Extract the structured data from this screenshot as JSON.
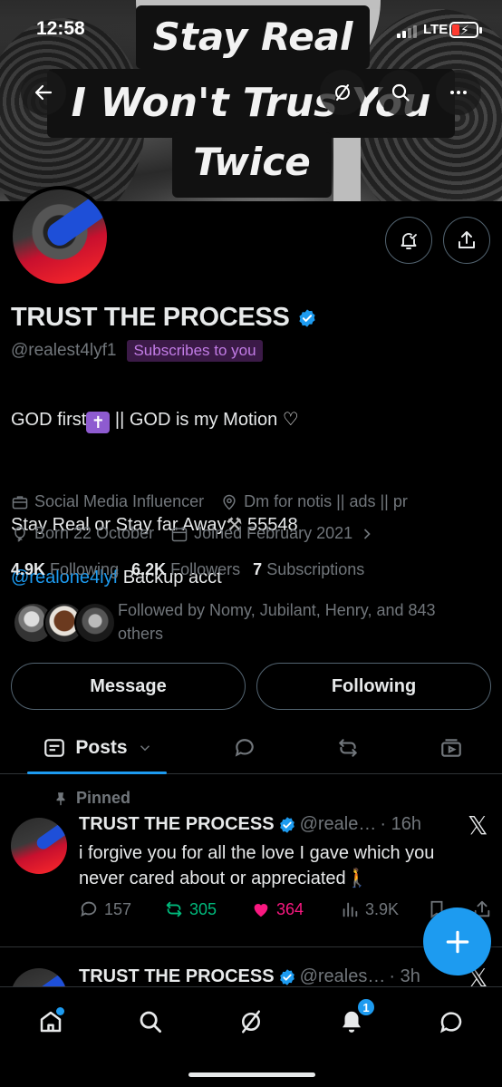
{
  "status_bar": {
    "time": "12:58",
    "network": "LTE"
  },
  "banner": {
    "captions": [
      "Stay Real",
      "I Won't Trus  You",
      "Twice"
    ]
  },
  "header_buttons": {
    "back": "back-arrow-icon",
    "grok": "grok-icon",
    "search": "search-icon",
    "more": "more-icon"
  },
  "profile": {
    "display_name": "TRUST THE PROCESS",
    "handle": "@realest4lyf1",
    "subscribes_badge": "Subscribes to you",
    "bio_line1_a": "GOD first",
    "bio_line1_b": " || GOD is my Motion",
    "bio_line2": "Stay Real or Stay far Away",
    "bio_line2_num": " 55548",
    "bio_link": "@realone4lyf",
    "bio_link_suffix": " Backup acct",
    "category": "Social Media Influencer",
    "location": "Dm for notis || ads || pr",
    "born": "Born 22 October",
    "joined": "Joined February 2021",
    "following_count": "4.9K",
    "following_label": "Following",
    "followers_count": "6.2K",
    "followers_label": "Followers",
    "subscriptions_count": "7",
    "subscriptions_label": "Subscriptions",
    "followed_by": "Followed by Nomy, Jubilant, Henry, and 843 others"
  },
  "buttons": {
    "message": "Message",
    "following": "Following"
  },
  "tabs": {
    "posts": "Posts"
  },
  "posts": [
    {
      "pinned_label": "Pinned",
      "name": "TRUST THE PROCESS",
      "handle": "@reale…",
      "time": "· 16h",
      "text": "i forgive you for all the love I gave which you never cared about or appreciated",
      "replies": "157",
      "reposts": "305",
      "likes": "364",
      "views": "3.9K"
    },
    {
      "name": "TRUST THE PROCESS",
      "handle": "@reales…",
      "time": "· 3h"
    }
  ],
  "bottom_nav": {
    "notifications_badge": "1"
  },
  "colors": {
    "accent": "#1d9bf0",
    "like": "#f91880",
    "repost": "#00ba7c",
    "muted": "#71767b"
  }
}
